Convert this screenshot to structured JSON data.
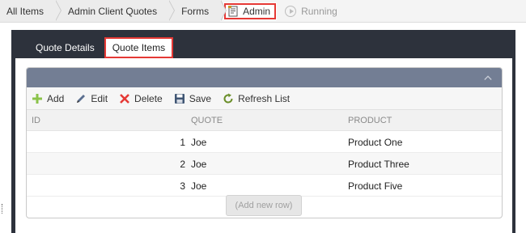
{
  "breadcrumb": {
    "items": [
      "All Items",
      "Admin Client Quotes",
      "Forms"
    ],
    "current": "Admin",
    "status": "Running"
  },
  "tabs": [
    "Quote Details",
    "Quote Items"
  ],
  "active_tab": "Quote Items",
  "toolbar": {
    "add": "Add",
    "edit": "Edit",
    "delete": "Delete",
    "save": "Save",
    "refresh": "Refresh List"
  },
  "columns": {
    "id": "ID",
    "quote": "QUOTE",
    "product": "PRODUCT"
  },
  "rows": [
    {
      "id": "1",
      "quote": "Joe",
      "product": "Product One"
    },
    {
      "id": "2",
      "quote": "Joe",
      "product": "Product Three"
    },
    {
      "id": "3",
      "quote": "Joe",
      "product": "Product Five"
    }
  ],
  "add_row_label": "(Add new row)",
  "colors": {
    "header_bar": "#737e94",
    "frame": "#2d323c",
    "highlight": "#e53935",
    "add_icon": "#8bc34a",
    "delete_icon": "#e53935",
    "edit_icon": "#5b6f8f",
    "save_icon": "#3f5573",
    "refresh_icon": "#6b8f2a"
  }
}
